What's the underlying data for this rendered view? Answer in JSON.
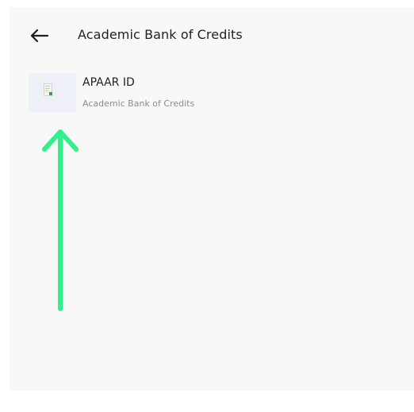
{
  "header": {
    "title": "Academic Bank of Credits",
    "back_icon": "arrow-left-icon"
  },
  "documents": [
    {
      "title": "APAAR ID",
      "subtitle": "Academic Bank of Credits",
      "icon": "document-icon"
    }
  ],
  "annotation": {
    "icon": "arrow-up-icon",
    "color": "#2ff08a"
  },
  "colors": {
    "background": "#f8f8f9",
    "thumbnail": "#eef0f8",
    "text_primary": "#1f1f24",
    "text_secondary": "#8a8c93"
  }
}
